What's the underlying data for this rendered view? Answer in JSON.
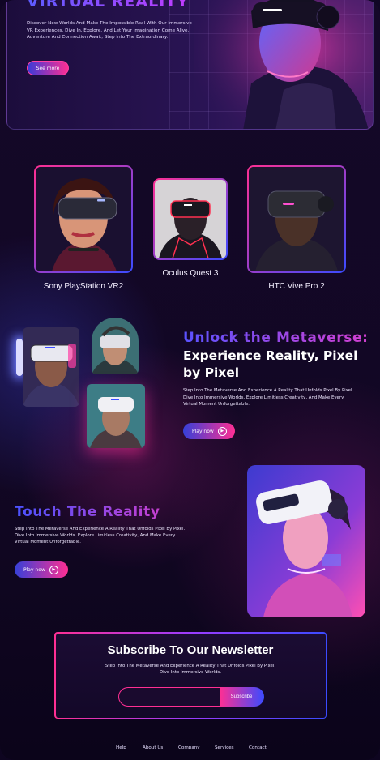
{
  "hero": {
    "title": "VIRTUAL REALITY",
    "description": "Discover New Worlds And Make The Impossible Real With Our Immersive VR Experiences. Dive In, Explore, And Let Your Imagination Come Alive. Adventure And Connection Await; Step Into The Extraordinary.",
    "button": "See more"
  },
  "products": [
    {
      "name": "Sony PlayStation VR2"
    },
    {
      "name": "Oculus Quest 3"
    },
    {
      "name": "HTC Vive Pro 2"
    }
  ],
  "metaverse": {
    "title_line1": "Unlock the Metaverse:",
    "title_line2": "Experience Reality, Pixel by Pixel",
    "description": "Step Into The Metaverse And Experience A Reality That Unfolds Pixel By Pixel. Dive Into Immersive Worlds, Explore Limitless Creativity, And Make Every Virtual Moment Unforgettable.",
    "button": "Play now"
  },
  "touch": {
    "title": "Touch The Reality",
    "description": "Step Into The Metaverse And Experience A Reality That Unfolds Pixel By Pixel. Dive Into Immersive Worlds. Explore Limitless Creativity, And Make Every Virtual Moment Unforgettable.",
    "button": "Play now"
  },
  "newsletter": {
    "title": "Subscribe To Our Newsletter",
    "description": "Step Into The Metaverse And Experience A Reality That Unfolds Pixel By Pixel. Dive Into Immersive Worlds.",
    "input_value": "",
    "button": "Subscribe"
  },
  "footer": {
    "links": [
      "Help",
      "About Us",
      "Company",
      "Services",
      "Contact"
    ]
  },
  "colors": {
    "accent_pink": "#ff2f93",
    "accent_blue": "#3b4bff",
    "accent_violet": "#6b55ff",
    "background": "#12072a"
  }
}
